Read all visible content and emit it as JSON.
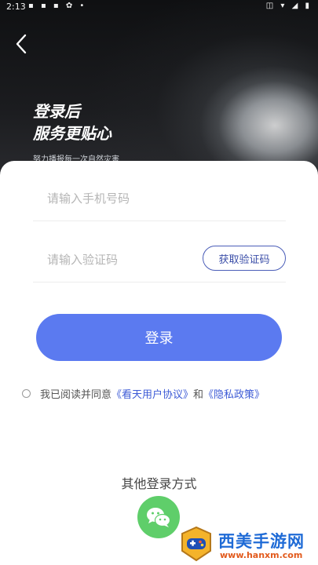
{
  "status_bar": {
    "time": "2:13",
    "left_icons": "▪ ▪ ▪ ✿ •",
    "right_icons": "◫ ▾ ◢ ▮"
  },
  "header": {
    "title_line1": "登录后",
    "title_line2": "服务更贴心",
    "subtitle": "努力播报每一次自然灾害"
  },
  "form": {
    "phone_placeholder": "请输入手机号码",
    "phone_value": "",
    "code_placeholder": "请输入验证码",
    "code_value": "",
    "get_code_label": "获取验证码",
    "login_label": "登录"
  },
  "agreement": {
    "prefix": "我已阅读并同意",
    "user_agreement": "《看天用户协议》",
    "and": "和",
    "privacy_policy": "《隐私政策》",
    "checked": false
  },
  "other_login": {
    "title": "其他登录方式",
    "icon": "wechat-icon"
  },
  "watermark": {
    "name": "西美手游网",
    "url": "www.hanxm.com"
  },
  "colors": {
    "primary": "#5b7af0",
    "link": "#3d5bd6",
    "wechat": "#5fce6a"
  }
}
